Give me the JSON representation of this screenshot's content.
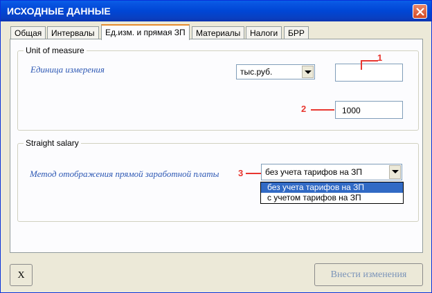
{
  "window": {
    "title": "ИСХОДНЫЕ ДАННЫЕ"
  },
  "tabs": [
    {
      "label": "Общая"
    },
    {
      "label": "Интервалы"
    },
    {
      "label": "Ед.изм. и прямая ЗП"
    },
    {
      "label": "Материалы"
    },
    {
      "label": "Налоги"
    },
    {
      "label": "БРР"
    }
  ],
  "active_tab": "Ед.изм. и прямая ЗП",
  "unit_group": {
    "legend": "Unit of measure",
    "label": "Единица измерения",
    "unit_select_value": "тыс.руб.",
    "unit_text_value": "",
    "multiplier_value": "1000"
  },
  "salary_group": {
    "legend": "Straight salary",
    "label": "Метод отображения прямой заработной платы",
    "method_select_value": "без учета тарифов на ЗП",
    "options": [
      "без учета тарифов на ЗП",
      "с учетом тарифов на ЗП"
    ],
    "selected_option_index": 0
  },
  "annotations": [
    "1",
    "2",
    "3"
  ],
  "buttons": {
    "close_label": "X",
    "apply_label": "Внести изменения"
  },
  "colors": {
    "annotation": "#e8362f",
    "title_bar": "#0046d5",
    "selection": "#316ac5",
    "label": "#2d58b4"
  }
}
